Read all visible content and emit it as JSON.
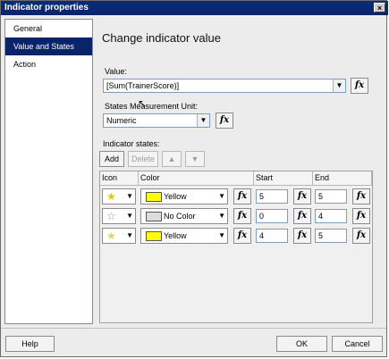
{
  "window": {
    "title": "Indicator properties",
    "close_icon": "×"
  },
  "sidebar": {
    "items": [
      {
        "label": "General",
        "selected": false
      },
      {
        "label": "Value and States",
        "selected": true
      },
      {
        "label": "Action",
        "selected": false
      }
    ]
  },
  "main": {
    "heading": "Change indicator value",
    "value_label": "Value:",
    "value_field": "[Sum(TrainerScore)]",
    "unit_label": "States Measurement Unit:",
    "unit_value": "Numeric",
    "states_label": "Indicator states:",
    "add_label": "Add",
    "delete_label": "Delete",
    "fx_label": "fx",
    "up_icon": "▲",
    "down_icon": "▼",
    "dropdown_icon": "▼"
  },
  "grid": {
    "headers": {
      "icon": "Icon",
      "color": "Color",
      "start": "Start",
      "end": "End"
    },
    "rows": [
      {
        "star": "★",
        "star_color": "#e3c600",
        "color_name": "Yellow",
        "swatch": "#ffff00",
        "start": "5",
        "end": "5"
      },
      {
        "star": "☆",
        "star_color": "#9a9a9a",
        "color_name": "No Color",
        "swatch": "#dddddd",
        "start": "0",
        "end": "4"
      },
      {
        "star": "★",
        "star_color": "#e3d360",
        "color_name": "Yellow",
        "swatch": "#ffff00",
        "start": "4",
        "end": "5"
      }
    ]
  },
  "footer": {
    "help_label": "Help",
    "ok_label": "OK",
    "cancel_label": "Cancel"
  },
  "colors": {
    "title_bar": "#0a246a",
    "selected_item": "#0a246a"
  }
}
